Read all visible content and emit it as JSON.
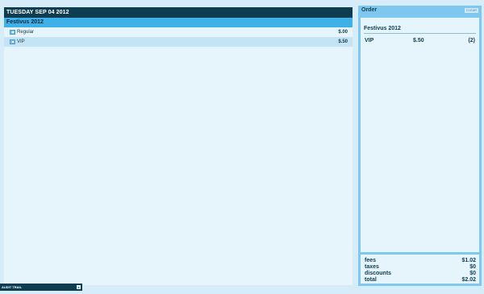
{
  "schedule": {
    "date_header": "TUESDAY SEP 04 2012",
    "event_title": "Festivus 2012",
    "tickets": [
      {
        "label": "Regular",
        "price": "$.00"
      },
      {
        "label": "VIP",
        "price": "$.50"
      }
    ]
  },
  "order": {
    "title": "Order",
    "clear_label": "CLEAR",
    "event_title": "Festivus 2012",
    "lines": [
      {
        "name": "VIP",
        "price": "$.50",
        "qty": "(2)"
      }
    ],
    "totals": [
      {
        "label": "fees",
        "value": "$1.02"
      },
      {
        "label": "taxes",
        "value": "$0"
      },
      {
        "label": "discounts",
        "value": "$0"
      },
      {
        "label": "total",
        "value": "$2.02"
      }
    ]
  },
  "audit_trail": {
    "label": "AUDIT TRAIL",
    "toggle": "x"
  }
}
